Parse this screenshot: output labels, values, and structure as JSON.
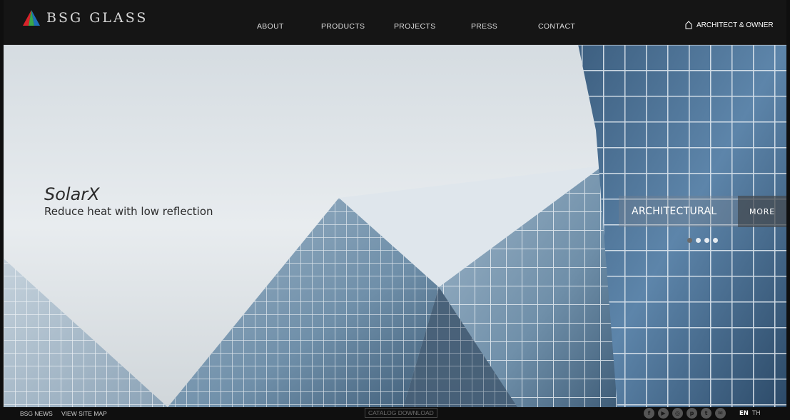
{
  "brand": {
    "name": "BSG GLASS"
  },
  "nav": {
    "items": [
      {
        "label": "ABOUT"
      },
      {
        "label": "PRODUCTS"
      },
      {
        "label": "PROJECTS"
      },
      {
        "label": "PRESS"
      },
      {
        "label": "CONTACT"
      }
    ],
    "owner_link": "ARCHITECT & OWNER"
  },
  "hero": {
    "product_title": "SolarX",
    "tagline": "Reduce heat with low reflection",
    "category": "ARCHITECTURAL",
    "more_label": "MORE",
    "slides_total": 4,
    "active_slide": 1
  },
  "footer": {
    "news_link": "BSG NEWS",
    "sitemap_link": "VIEW SITE MAP",
    "catalog_button": "CATALOG DOWNLOAD",
    "social": [
      {
        "icon": "facebook-icon",
        "glyph": "f"
      },
      {
        "icon": "youtube-icon",
        "glyph": "▶"
      },
      {
        "icon": "instagram-icon",
        "glyph": "◎"
      },
      {
        "icon": "pinterest-icon",
        "glyph": "p"
      },
      {
        "icon": "twitter-icon",
        "glyph": "t"
      },
      {
        "icon": "email-icon",
        "glyph": "✉"
      }
    ],
    "languages": {
      "active": "EN",
      "other": "TH"
    }
  },
  "colors": {
    "nav_background": "#151515",
    "footer_background": "#0f0f0f",
    "logo_red": "#d8232a",
    "logo_green": "#3aa64a",
    "logo_blue": "#1f6fb8"
  }
}
